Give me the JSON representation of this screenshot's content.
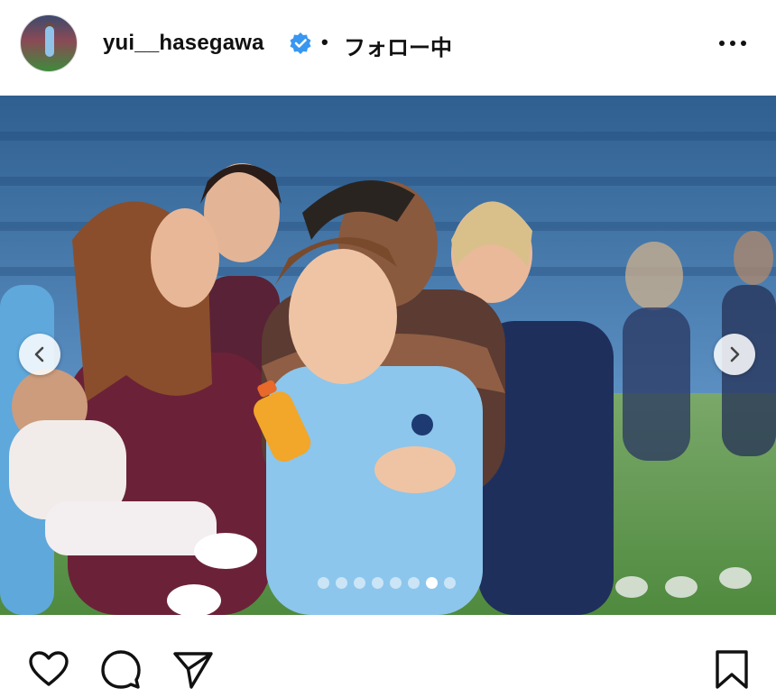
{
  "header": {
    "username": "yui__hasegawa",
    "separator": "•",
    "follow_status": "フォロー中"
  },
  "icons": {
    "avatar": "profile-avatar",
    "verified": "verified-badge-icon",
    "more": "more-options-icon",
    "prev": "chevron-left-icon",
    "next": "chevron-right-icon",
    "like": "heart-icon",
    "comment": "comment-bubble-icon",
    "share": "paper-plane-icon",
    "save": "bookmark-icon"
  },
  "carousel": {
    "slide_count": 8,
    "active_index": 6
  },
  "colors": {
    "verified": "#3897f0",
    "text": "#111111",
    "background": "#ffffff"
  }
}
